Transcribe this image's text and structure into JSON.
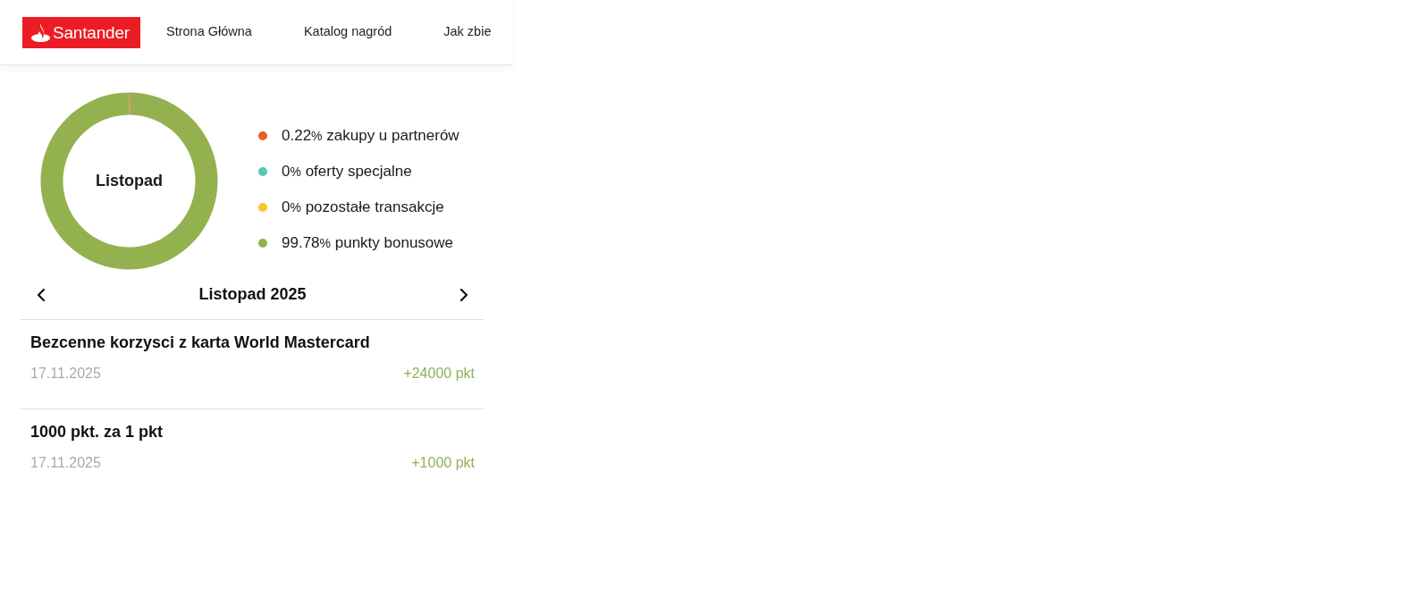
{
  "header": {
    "logo": {
      "text": "Santander"
    },
    "nav": [
      "Strona Główna",
      "Katalog nagród",
      "Jak zbie"
    ]
  },
  "summary": {
    "chart_data": {
      "type": "donut",
      "title": "Listopad",
      "values": [
        0.22,
        0,
        0,
        99.78
      ]
    },
    "legend": [
      {
        "value": "0.22",
        "unit": "%",
        "label": "zakupy u partnerów",
        "color": "#e95f25"
      },
      {
        "value": "0",
        "unit": "%",
        "label": "oferty specjalne",
        "color": "#55c9b3"
      },
      {
        "value": "0",
        "unit": "%",
        "label": "pozostałe transakcje",
        "color": "#fec32a"
      },
      {
        "value": "99.78",
        "unit": "%",
        "label": "punkty bonusowe",
        "color": "#93b14f"
      }
    ]
  },
  "month_nav": {
    "title": "Listopad 2025"
  },
  "transactions": [
    {
      "title": "Bezcenne korzysci z karta World Mastercard",
      "date": "17.11.2025",
      "points": "+24000 pkt"
    },
    {
      "title": "1000 pkt. za 1 pkt",
      "date": "17.11.2025",
      "points": "+1000 pkt"
    }
  ]
}
